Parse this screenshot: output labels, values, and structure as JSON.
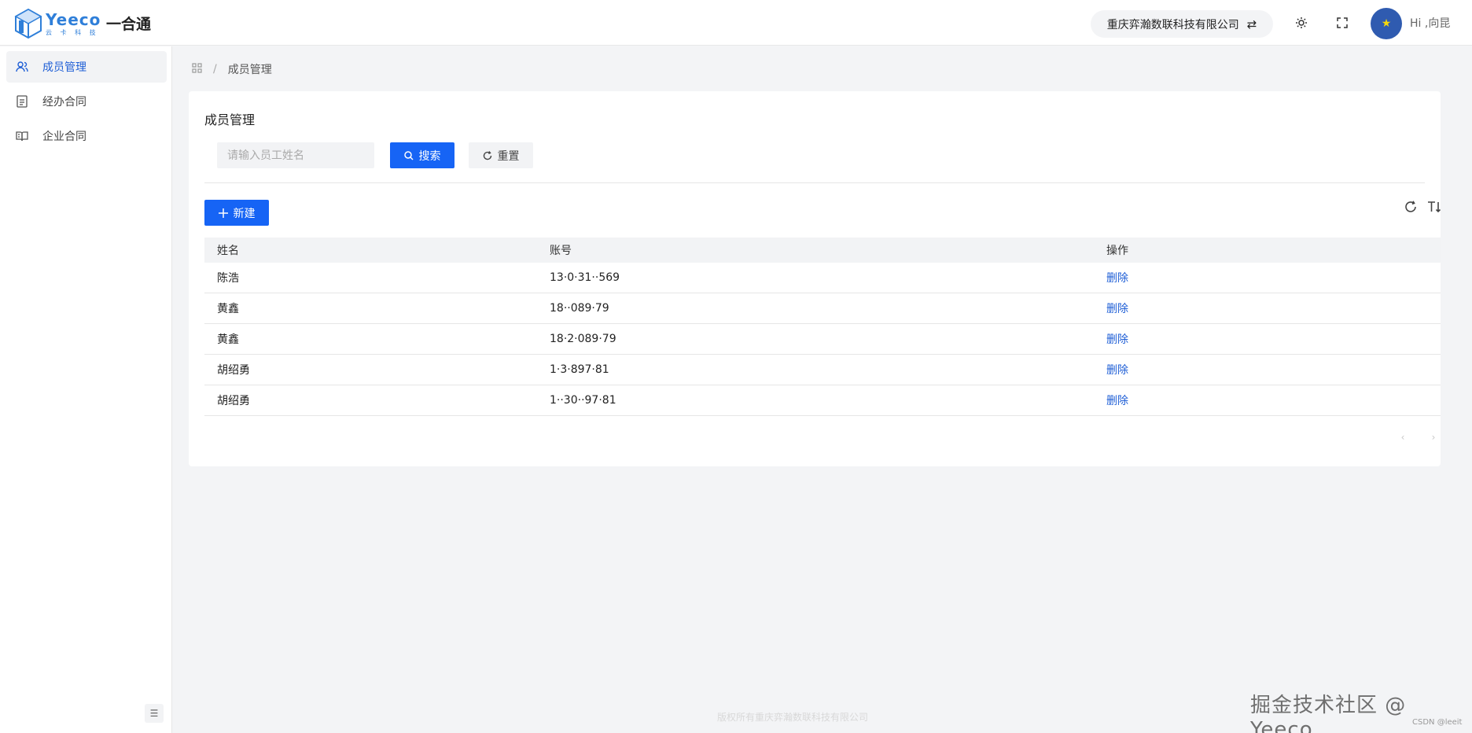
{
  "header": {
    "logo_word": "Yeeco",
    "logo_sub": "云 卡 科 技",
    "app_name": "一合通",
    "company": "重庆弈瀚数联科技有限公司",
    "swap_icon": "swap-icon",
    "greeting": "Hi ,向昆"
  },
  "sidebar": {
    "items": [
      {
        "label": "成员管理",
        "icon": "users-icon",
        "active": true
      },
      {
        "label": "经办合同",
        "icon": "document-icon",
        "active": false
      },
      {
        "label": "企业合同",
        "icon": "book-icon",
        "active": false
      }
    ]
  },
  "breadcrumb": {
    "current": "成员管理",
    "separator": "/"
  },
  "card": {
    "title": "成员管理",
    "search_placeholder": "请输入员工姓名",
    "search_label": "搜索",
    "reset_label": "重置",
    "new_label": "新建"
  },
  "table": {
    "columns": {
      "name": "姓名",
      "account": "账号",
      "action": "操作"
    },
    "rows": [
      {
        "name": "陈浩",
        "account": "13·0·31··569",
        "action": "删除"
      },
      {
        "name": "黄鑫",
        "account": "18··089·79",
        "action": "删除"
      },
      {
        "name": "黄鑫",
        "account": "18·2·089·79",
        "action": "删除"
      },
      {
        "name": "胡绍勇",
        "account": "1·3·897·81",
        "action": "删除"
      },
      {
        "name": "胡绍勇",
        "account": "1··30··97·81",
        "action": "删除"
      }
    ]
  },
  "footer": "版权所有重庆弈瀚数联科技有限公司",
  "watermark": "掘金技术社区 @ Yeeco",
  "watermark_small": "CSDN @leeit",
  "colors": {
    "primary": "#1664f5",
    "link": "#1f5fd6",
    "avatar": "#2f5bb0"
  }
}
